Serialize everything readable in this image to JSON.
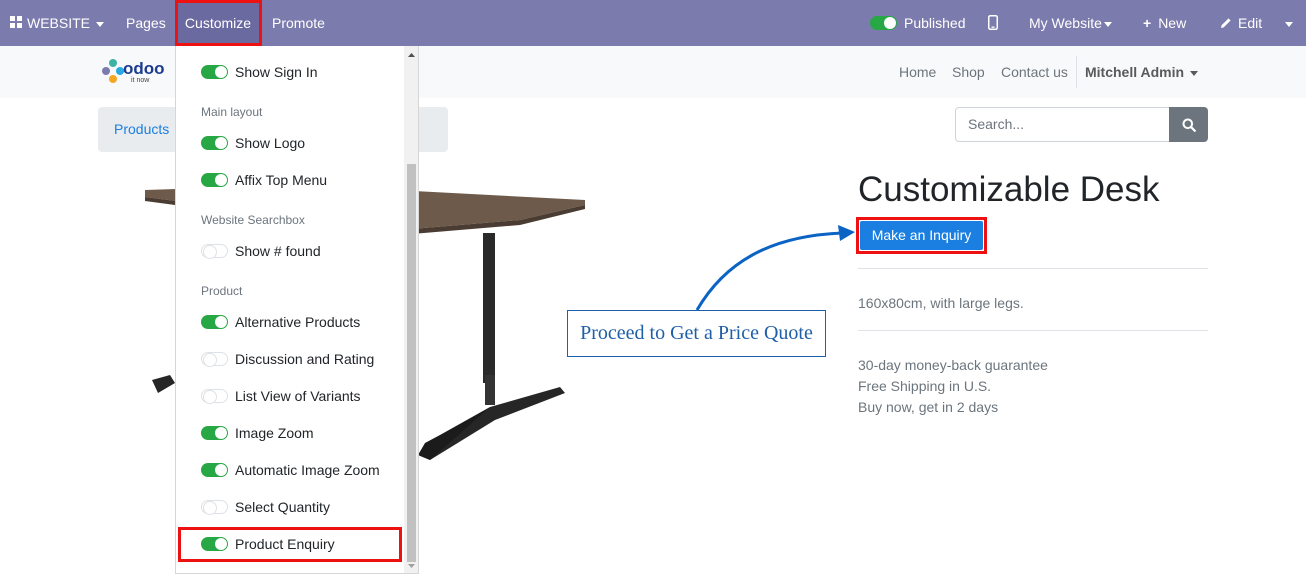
{
  "topbar": {
    "website_label": "WEBSITE",
    "pages_label": "Pages",
    "customize_label": "Customize",
    "promote_label": "Promote",
    "published_label": "Published",
    "my_website_label": "My Website",
    "new_label": "New",
    "edit_label": "Edit",
    "bg_color": "#7c7bad"
  },
  "site_header": {
    "logo_text": "odoo",
    "logo_sub": "it now",
    "nav": [
      "Home",
      "Shop",
      "Contact us"
    ],
    "user": "Mitchell Admin"
  },
  "breadcrumb": {
    "products": "Products"
  },
  "search": {
    "placeholder": "Search..."
  },
  "customize_menu": {
    "items": [
      {
        "type": "toggle",
        "label": "Show Sign In",
        "on": true
      },
      {
        "type": "header",
        "label": "Main layout"
      },
      {
        "type": "toggle",
        "label": "Show Logo",
        "on": true
      },
      {
        "type": "toggle",
        "label": "Affix Top Menu",
        "on": true
      },
      {
        "type": "header",
        "label": "Website Searchbox"
      },
      {
        "type": "toggle",
        "label": "Show # found",
        "on": false
      },
      {
        "type": "header",
        "label": "Product"
      },
      {
        "type": "toggle",
        "label": "Alternative Products",
        "on": true
      },
      {
        "type": "toggle",
        "label": "Discussion and Rating",
        "on": false
      },
      {
        "type": "toggle",
        "label": "List View of Variants",
        "on": false
      },
      {
        "type": "toggle",
        "label": "Image Zoom",
        "on": true
      },
      {
        "type": "toggle",
        "label": "Automatic Image Zoom",
        "on": true
      },
      {
        "type": "toggle",
        "label": "Select Quantity",
        "on": false
      },
      {
        "type": "toggle",
        "label": "Product Enquiry",
        "on": true
      }
    ]
  },
  "product": {
    "title": "Customizable Desk",
    "inquiry_button": "Make an Inquiry",
    "description": "160x80cm, with large legs.",
    "guarantees": [
      "30-day money-back guarantee",
      "Free Shipping in U.S.",
      "Buy now, get in 2 days"
    ]
  },
  "annotation": {
    "callout": "Proceed to Get a Price Quote",
    "arrow_color": "#0b63c4",
    "highlight_color": "#e11111"
  }
}
